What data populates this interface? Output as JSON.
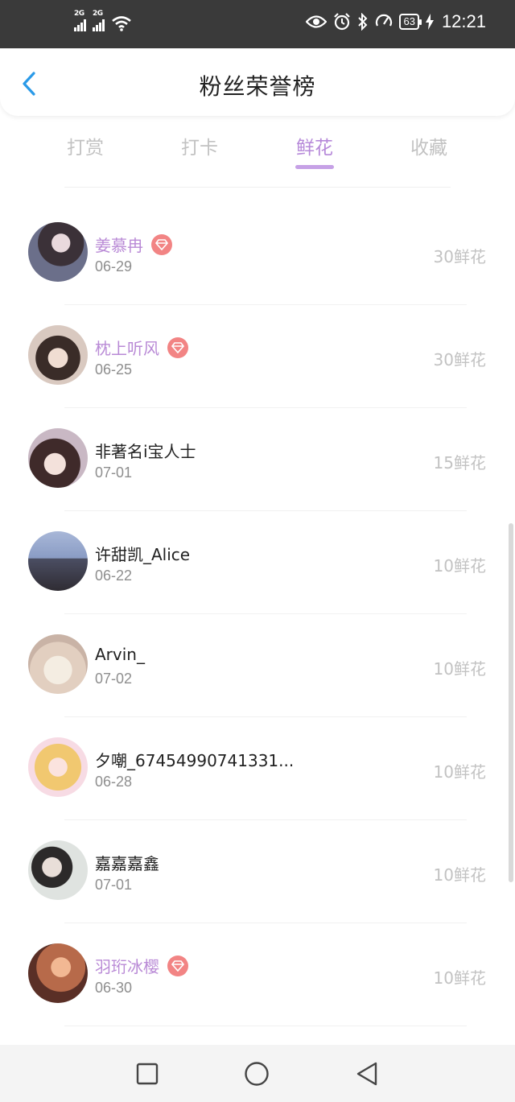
{
  "status_bar": {
    "sim1": "2G",
    "sim2": "2G",
    "battery": "63",
    "time": "12:21"
  },
  "header": {
    "title": "粉丝荣誉榜"
  },
  "tabs": [
    {
      "label": "打赏",
      "active": false
    },
    {
      "label": "打卡",
      "active": false
    },
    {
      "label": "鲜花",
      "active": true
    },
    {
      "label": "收藏",
      "active": false
    }
  ],
  "fans": [
    {
      "name": "姜慕冉",
      "date": "06-29",
      "amount": "30鲜花",
      "vip": true
    },
    {
      "name": "枕上听风",
      "date": "06-25",
      "amount": "30鲜花",
      "vip": true
    },
    {
      "name": "非著名i宝人士",
      "date": "07-01",
      "amount": "15鲜花",
      "vip": false
    },
    {
      "name": "许甜凯_Alice",
      "date": "06-22",
      "amount": "10鲜花",
      "vip": false
    },
    {
      "name": "Arvin_",
      "date": "07-02",
      "amount": "10鲜花",
      "vip": false
    },
    {
      "name": "夕嘲_67454990741331...",
      "date": "06-28",
      "amount": "10鲜花",
      "vip": false
    },
    {
      "name": "嘉嘉嘉鑫",
      "date": "07-01",
      "amount": "10鲜花",
      "vip": false
    },
    {
      "name": "羽珩冰樱",
      "date": "06-30",
      "amount": "10鲜花",
      "vip": true
    }
  ],
  "colors": {
    "accent": "#b689d9",
    "vip_name": "#b98ad6",
    "vip_badge": "#f28484",
    "muted": "#c2c2c2",
    "back_arrow": "#2a9ae8"
  },
  "icons": {
    "back": "chevron-left-icon",
    "vip": "diamond-icon",
    "nav": [
      "square-icon",
      "circle-icon",
      "triangle-back-icon"
    ]
  }
}
